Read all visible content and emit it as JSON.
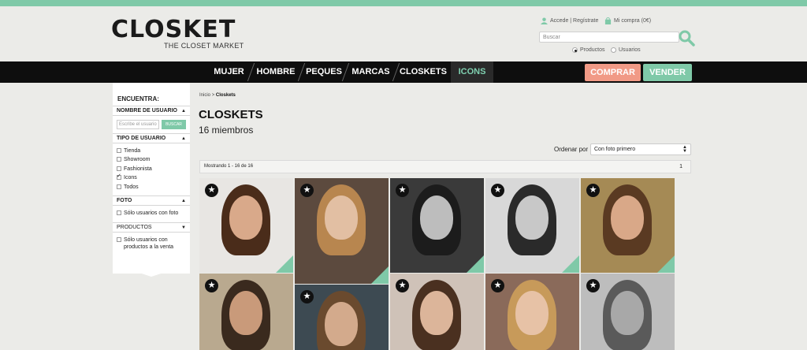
{
  "brand": {
    "name": "CLOSKET",
    "tagline": "THE CLOSET MARKET"
  },
  "account": {
    "login": "Accede | Regístrate",
    "cart": "Mi compra (0€)"
  },
  "search": {
    "placeholder": "Buscar",
    "options": [
      "Productos",
      "Usuarios"
    ],
    "selected": "Productos"
  },
  "nav": {
    "items": [
      "MUJER",
      "HOMBRE",
      "PEQUES",
      "MARCAS",
      "CLOSKETS",
      "ICONS"
    ],
    "active": "ICONS"
  },
  "actions": {
    "buy": "COMPRAR",
    "sell": "VENDER"
  },
  "colors": {
    "accent": "#7fc9a8",
    "buy": "#f19a86",
    "nav_bg": "#0e0e0e"
  },
  "sidebar": {
    "title": "ENCUENTRA:",
    "username_section": "NOMBRE DE USUARIO",
    "username_placeholder": "Escribe el usuario",
    "username_button": "BUSCAR",
    "type_section": "TIPO DE USUARIO",
    "types": [
      {
        "label": "Tienda",
        "checked": false
      },
      {
        "label": "Showroom",
        "checked": false
      },
      {
        "label": "Fashionista",
        "checked": false
      },
      {
        "label": "Icons",
        "checked": true
      },
      {
        "label": "Todos",
        "checked": false
      }
    ],
    "photo_section": "FOTO",
    "photo_option": "Sólo usuarios con foto",
    "products_section": "PRODUCTOS",
    "products_option": "Sólo usuarios con productos a la venta"
  },
  "breadcrumb": {
    "home": "Inicio",
    "sep": ">",
    "current": "Closkets"
  },
  "page": {
    "title": "CLOSKETS",
    "subtitle": "16 miembros"
  },
  "sort": {
    "label": "Ordenar por",
    "value": "Con foto primero"
  },
  "pagination": {
    "showing": "Mostrando 1 - 16 de 16",
    "page": "1"
  },
  "members": [
    {
      "bg": "#e8e6e3",
      "skin": "#d9a98a",
      "hair": "#4a2c1a"
    },
    {
      "bg": "#5c4a3e",
      "skin": "#e2bfa3",
      "hair": "#b8864f"
    },
    {
      "bg": "#3a3a3a",
      "skin": "#bdbdbd",
      "hair": "#1c1c1c"
    },
    {
      "bg": "#d8d8d8",
      "skin": "#c8c8c8",
      "hair": "#2a2a2a"
    },
    {
      "bg": "#a58a55",
      "skin": "#d9a888",
      "hair": "#5a3a22"
    },
    {
      "bg": "#b9a98f",
      "skin": "#c99a7a",
      "hair": "#3a2a1e"
    },
    {
      "bg": "#3d4a52",
      "skin": "#d3aa8c",
      "hair": "#6a4a2e"
    },
    {
      "bg": "#cfc2b8",
      "skin": "#dcb59a",
      "hair": "#4a3020"
    },
    {
      "bg": "#8a6a5a",
      "skin": "#e7c2a6",
      "hair": "#c79a5a"
    },
    {
      "bg": "#bdbdbd",
      "skin": "#a8a8a8",
      "hair": "#5a5a5a"
    }
  ]
}
